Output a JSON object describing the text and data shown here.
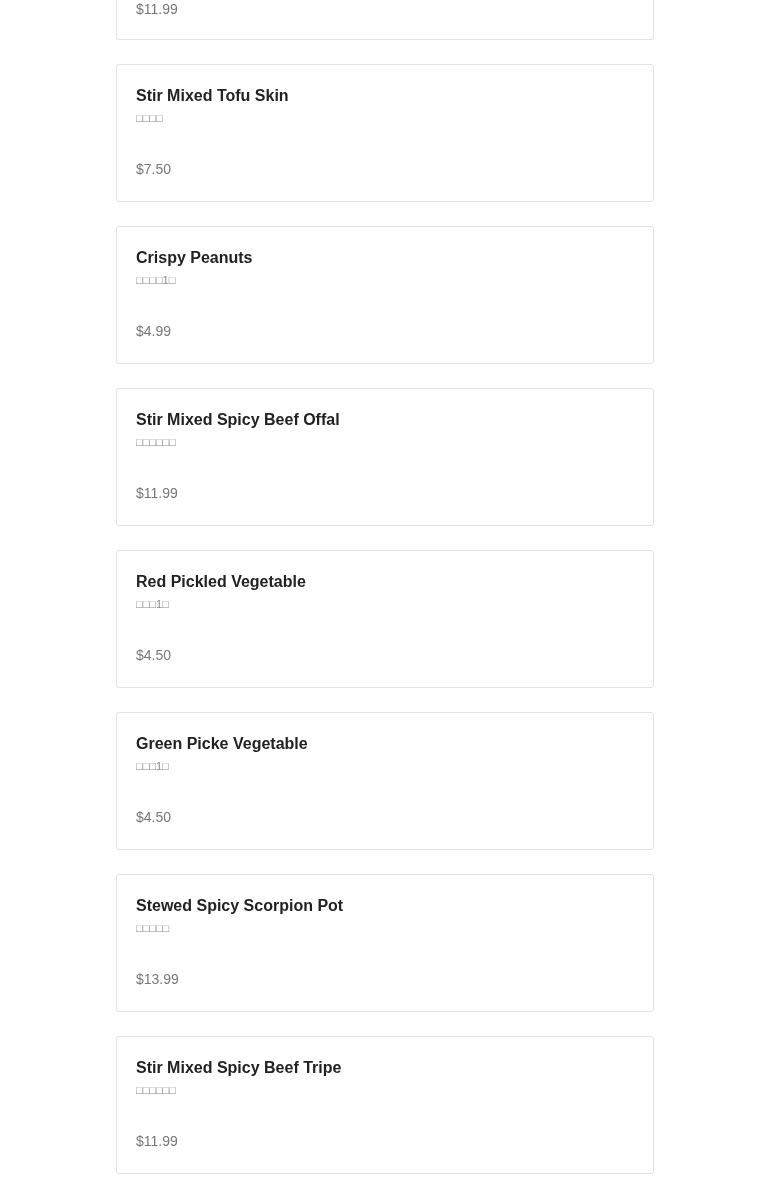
{
  "items": [
    {
      "price": "$11.99"
    },
    {
      "name": "Stir Mixed Tofu Skin",
      "subtitle": "□□□□",
      "price": "$7.50"
    },
    {
      "name": "Crispy Peanuts",
      "subtitle": "□□□□1□",
      "price": "$4.99"
    },
    {
      "name": "Stir Mixed Spicy Beef Offal",
      "subtitle": "□□□□□□",
      "price": "$11.99"
    },
    {
      "name": "Red Pickled Vegetable",
      "subtitle": "□□□1□",
      "price": "$4.50"
    },
    {
      "name": "Green Picke Vegetable",
      "subtitle": "□□□1□",
      "price": "$4.50"
    },
    {
      "name": "Stewed Spicy Scorpion Pot",
      "subtitle": "□□□□□",
      "price": "$13.99"
    },
    {
      "name": "Stir Mixed Spicy Beef Tripe",
      "subtitle": "□□□□□□",
      "price": "$11.99"
    }
  ]
}
